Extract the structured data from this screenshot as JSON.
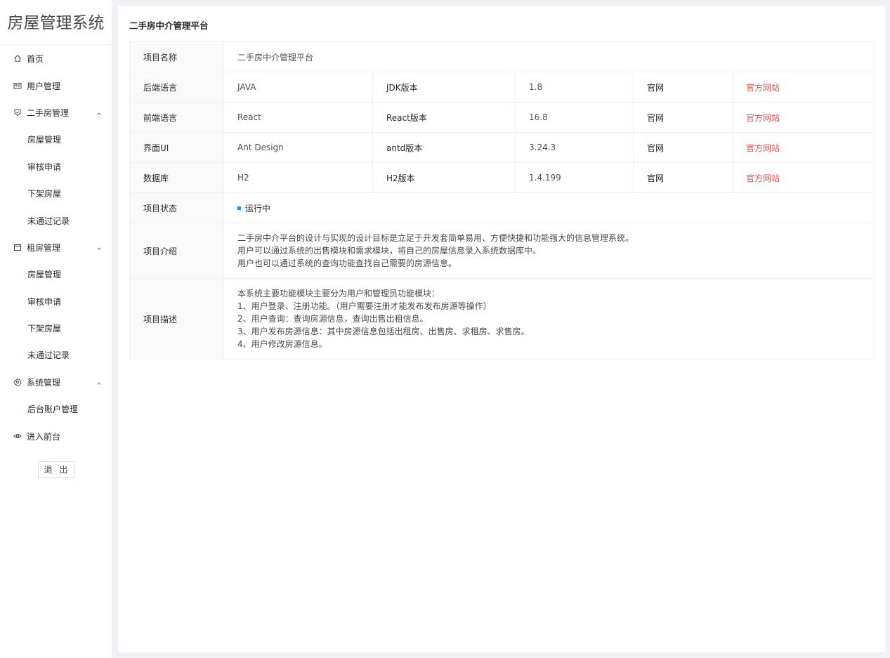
{
  "app": {
    "title": "房屋管理系统"
  },
  "sidebar": {
    "items": [
      {
        "label": "首页",
        "icon": "home-icon"
      },
      {
        "label": "用户管理",
        "icon": "idcard-icon"
      },
      {
        "label": "二手房管理",
        "icon": "shield-icon",
        "expanded": true
      },
      {
        "label": "房屋管理"
      },
      {
        "label": "审核申请"
      },
      {
        "label": "下架房屋"
      },
      {
        "label": "未通过记录"
      },
      {
        "label": "租房管理",
        "icon": "calendar-icon",
        "expanded": true
      },
      {
        "label": "房屋管理"
      },
      {
        "label": "审核申请"
      },
      {
        "label": "下架房屋"
      },
      {
        "label": "未通过记录"
      },
      {
        "label": "系统管理",
        "icon": "gear-icon",
        "expanded": true
      },
      {
        "label": "后台账户管理"
      },
      {
        "label": "进入前台",
        "icon": "eye-icon"
      }
    ],
    "logout_label": "退 出"
  },
  "main": {
    "title": "二手房中介管理平台",
    "project_name_label": "项目名称",
    "project_name": "二手房中介管理平台",
    "rows": [
      {
        "label": "后端语言",
        "value": "JAVA",
        "ver_label": "JDK版本",
        "ver": "1.8",
        "site_label": "官网",
        "site_link": "官方网站"
      },
      {
        "label": "前端语言",
        "value": "React",
        "ver_label": "React版本",
        "ver": "16.8",
        "site_label": "官网",
        "site_link": "官方网站"
      },
      {
        "label": "界面UI",
        "value": "Ant Design",
        "ver_label": "antd版本",
        "ver": "3.24.3",
        "site_label": "官网",
        "site_link": "官方网站"
      },
      {
        "label": "数据库",
        "value": "H2",
        "ver_label": "H2版本",
        "ver": "1.4.199",
        "site_label": "官网",
        "site_link": "官方网站"
      }
    ],
    "status_label": "项目状态",
    "status": "运行中",
    "intro_label": "项目介绍",
    "intro_lines": [
      "二手房中介平台的设计与实现的设计目标是立足于开发套简单易用、方便快捷和功能强大的信息管理系统。",
      "用户可以通过系统的出售模块和需求模块，将自己的房屋信息录入系统数据库中。",
      "用户也可以通过系统的查询功能查找自己需要的房源信息。"
    ],
    "desc_label": "项目描述",
    "desc_lines": [
      "本系统主要功能模块主要分为用户和管理员功能模块：",
      "1、用户登录、注册功能。（用户需要注册才能发布发布房源等操作）",
      "2、用户查询：查询房源信息，查询出售出租信息。",
      "3、用户发布房源信息：其中房源信息包括出租房、出售房、求租房、求售房。",
      "4、用户修改房源信息。"
    ]
  },
  "colors": {
    "link": "#e2504f",
    "status": "#1890ff"
  }
}
